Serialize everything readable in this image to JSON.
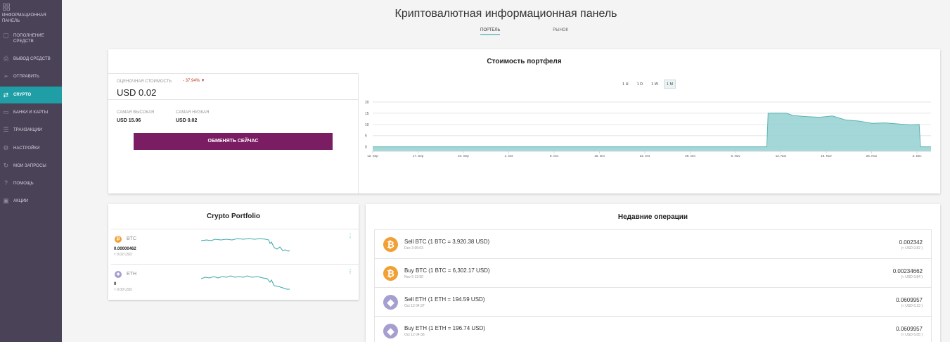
{
  "sidebar": {
    "items": [
      {
        "label": "ИНФОРМАЦИОННАЯ ПАНЕЛЬ",
        "icon": "grid-icon"
      },
      {
        "label": "ПОПОЛНЕНИЕ СРЕДСТВ",
        "icon": "deposit-icon"
      },
      {
        "label": "ВЫВОД СРЕДСТВ",
        "icon": "withdraw-icon"
      },
      {
        "label": "ОТПРАВИТЬ",
        "icon": "send-icon"
      },
      {
        "label": "CRYPTO",
        "icon": "exchange-icon"
      },
      {
        "label": "БАНКИ И КАРТЫ",
        "icon": "card-icon"
      },
      {
        "label": "ТРАНЗАКЦИИ",
        "icon": "transactions-icon"
      },
      {
        "label": "НАСТРОЙКИ",
        "icon": "gear-icon"
      },
      {
        "label": "МОИ ЗАПРОСЫ",
        "icon": "refresh-icon"
      },
      {
        "label": "ПОМОЩЬ",
        "icon": "help-icon"
      },
      {
        "label": "АКЦИИ",
        "icon": "gift-icon"
      }
    ]
  },
  "header": {
    "title": "Криптовалютная информационная панель",
    "tabs": [
      {
        "label": "ПОРТЕЛЬ"
      },
      {
        "label": "РЫНОК"
      }
    ]
  },
  "portfolio_value": {
    "title": "Стоимость портфеля",
    "estimated_label": "ОЦЕНОЧНАЯ СТОИМОСТЬ",
    "change": "- 37.94% ▼",
    "value": "USD 0.02",
    "high_label": "САМАЯ ВЫСОКАЯ",
    "high_value": "USD 15.06",
    "low_label": "САМАЯ НИЗКАЯ",
    "low_value": "USD 0.02",
    "exchange_button": "ОБМЕНЯТЬ СЕЙЧАС",
    "ranges": [
      "1 H",
      "1 D",
      "1 W",
      "1 M"
    ],
    "active_range": "1 M"
  },
  "chart_data": {
    "type": "area",
    "x_ticks": [
      "12. Sep",
      "17. Sep",
      "24. Sep",
      "1. Oct",
      "8. Oct",
      "15. Oct",
      "22. Oct",
      "29. Oct",
      "5. Nov",
      "12. Nov",
      "19. Nov",
      "26. Nov",
      "3. Dec"
    ],
    "y_ticks": [
      0,
      5,
      10,
      15,
      20
    ],
    "ylim": [
      -2,
      20
    ],
    "xlim": [
      0,
      85
    ],
    "points": [
      [
        0,
        0
      ],
      [
        60,
        0
      ],
      [
        60.2,
        15
      ],
      [
        61,
        15.06
      ],
      [
        63,
        15
      ],
      [
        64,
        14
      ],
      [
        66,
        13.5
      ],
      [
        68,
        13.2
      ],
      [
        70,
        13.8
      ],
      [
        72,
        12
      ],
      [
        74,
        11.5
      ],
      [
        76,
        10.5
      ],
      [
        78,
        10.7
      ],
      [
        80,
        10.2
      ],
      [
        82,
        9.8
      ],
      [
        83.2,
        10
      ],
      [
        83.4,
        0
      ],
      [
        85,
        0
      ]
    ],
    "color": "#94d1d1",
    "line_color": "#5fb3b3",
    "grid": true
  },
  "crypto_portfolio": {
    "title": "Crypto Portfolio",
    "coins": [
      {
        "symbol": "BTC",
        "amount": "0.00000462",
        "usd": "≈ 0.02 USD",
        "color": "#f0a035",
        "badge": "₿"
      },
      {
        "symbol": "ETH",
        "amount": "0",
        "usd": "≈ 0.00 USD",
        "color": "#a59fcf",
        "badge": "◆"
      }
    ]
  },
  "recent_operations": {
    "title": "Недавние операции",
    "items": [
      {
        "desc": "Sell BTC (1 BTC = 3,920.38 USD)",
        "date": "Dec 3 05:03",
        "amount": "0.002342",
        "usd": "(≈ USD 9.82 )",
        "color": "#f0a035",
        "badge": "₿"
      },
      {
        "desc": "Buy BTC (1 BTC = 6,302.17 USD)",
        "date": "Nov 9 12:50",
        "amount": "0.00234662",
        "usd": "(≈ USD 9.84 )",
        "color": "#f0a035",
        "badge": "₿"
      },
      {
        "desc": "Sell ETH (1 ETH = 194.59 USD)",
        "date": "Oct 12 04:37",
        "amount": "0.0609957",
        "usd": "(≈ USD 6.13 )",
        "color": "#a59fcf",
        "badge": "◆"
      },
      {
        "desc": "Buy ETH (1 ETH = 196.74 USD)",
        "date": "Oct 12 04:36",
        "amount": "0.0609957",
        "usd": "(≈ USD 6.05 )",
        "color": "#a59fcf",
        "badge": "◆"
      }
    ]
  }
}
